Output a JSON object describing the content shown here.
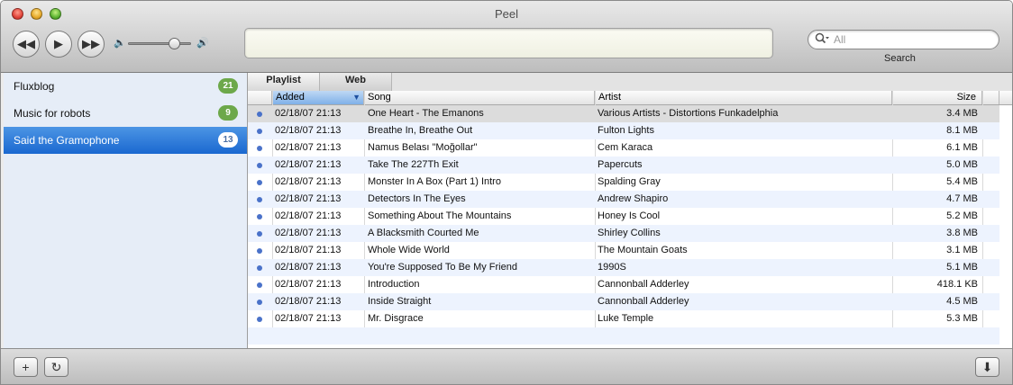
{
  "window": {
    "title": "Peel"
  },
  "toolbar": {
    "rewind_glyph": "◀◀",
    "play_glyph": "▶",
    "forward_glyph": "▶▶",
    "volume_low_glyph": "🔈",
    "volume_high_glyph": "🔊",
    "volume_level": 0.7,
    "search_placeholder": "All",
    "search_label": "Search"
  },
  "sidebar": {
    "items": [
      {
        "label": "Fluxblog",
        "count": "21",
        "selected": false
      },
      {
        "label": "Music for robots",
        "count": "9",
        "selected": false
      },
      {
        "label": "Said the Gramophone",
        "count": "13",
        "selected": true
      }
    ]
  },
  "tabs": {
    "playlist": "Playlist",
    "web": "Web"
  },
  "table": {
    "columns": {
      "added": "Added",
      "song": "Song",
      "artist": "Artist",
      "size": "Size"
    },
    "sort_arrow": "▼",
    "rows": [
      {
        "added": "02/18/07 21:13",
        "song": "One Heart - The Emanons",
        "artist": "Various Artists - Distortions Funkadelphia",
        "size": "3.4 MB"
      },
      {
        "added": "02/18/07 21:13",
        "song": "Breathe In, Breathe Out",
        "artist": "Fulton Lights",
        "size": "8.1 MB"
      },
      {
        "added": "02/18/07 21:13",
        "song": "Namus Belası \"Moğollar\"",
        "artist": "Cem Karaca",
        "size": "6.1 MB"
      },
      {
        "added": "02/18/07 21:13",
        "song": "Take The 227Th Exit",
        "artist": "Papercuts",
        "size": "5.0 MB"
      },
      {
        "added": "02/18/07 21:13",
        "song": "Monster In A Box (Part 1) Intro",
        "artist": "Spalding Gray",
        "size": "5.4 MB"
      },
      {
        "added": "02/18/07 21:13",
        "song": "Detectors In The Eyes",
        "artist": "Andrew Shapiro",
        "size": "4.7 MB"
      },
      {
        "added": "02/18/07 21:13",
        "song": "Something About The Mountains",
        "artist": "Honey Is Cool",
        "size": "5.2 MB"
      },
      {
        "added": "02/18/07 21:13",
        "song": "A Blacksmith Courted Me",
        "artist": "Shirley Collins",
        "size": "3.8 MB"
      },
      {
        "added": "02/18/07 21:13",
        "song": "Whole Wide World",
        "artist": "The Mountain Goats",
        "size": "3.1 MB"
      },
      {
        "added": "02/18/07 21:13",
        "song": "You're Supposed To Be My Friend",
        "artist": "1990S",
        "size": "5.1 MB"
      },
      {
        "added": "02/18/07 21:13",
        "song": "Introduction",
        "artist": "Cannonball Adderley",
        "size": "418.1 KB"
      },
      {
        "added": "02/18/07 21:13",
        "song": "Inside Straight",
        "artist": "Cannonball Adderley",
        "size": "4.5 MB"
      },
      {
        "added": "02/18/07 21:13",
        "song": "Mr. Disgrace",
        "artist": "Luke Temple",
        "size": "5.3 MB"
      }
    ]
  },
  "bottombar": {
    "add_glyph": "+",
    "refresh_glyph": "↻",
    "download_glyph": "⬇"
  },
  "colors": {
    "selection": "#1a68d0",
    "badge_green": "#6da84a",
    "row_alt": "#edf3fe",
    "dot": "#4a72c9"
  }
}
